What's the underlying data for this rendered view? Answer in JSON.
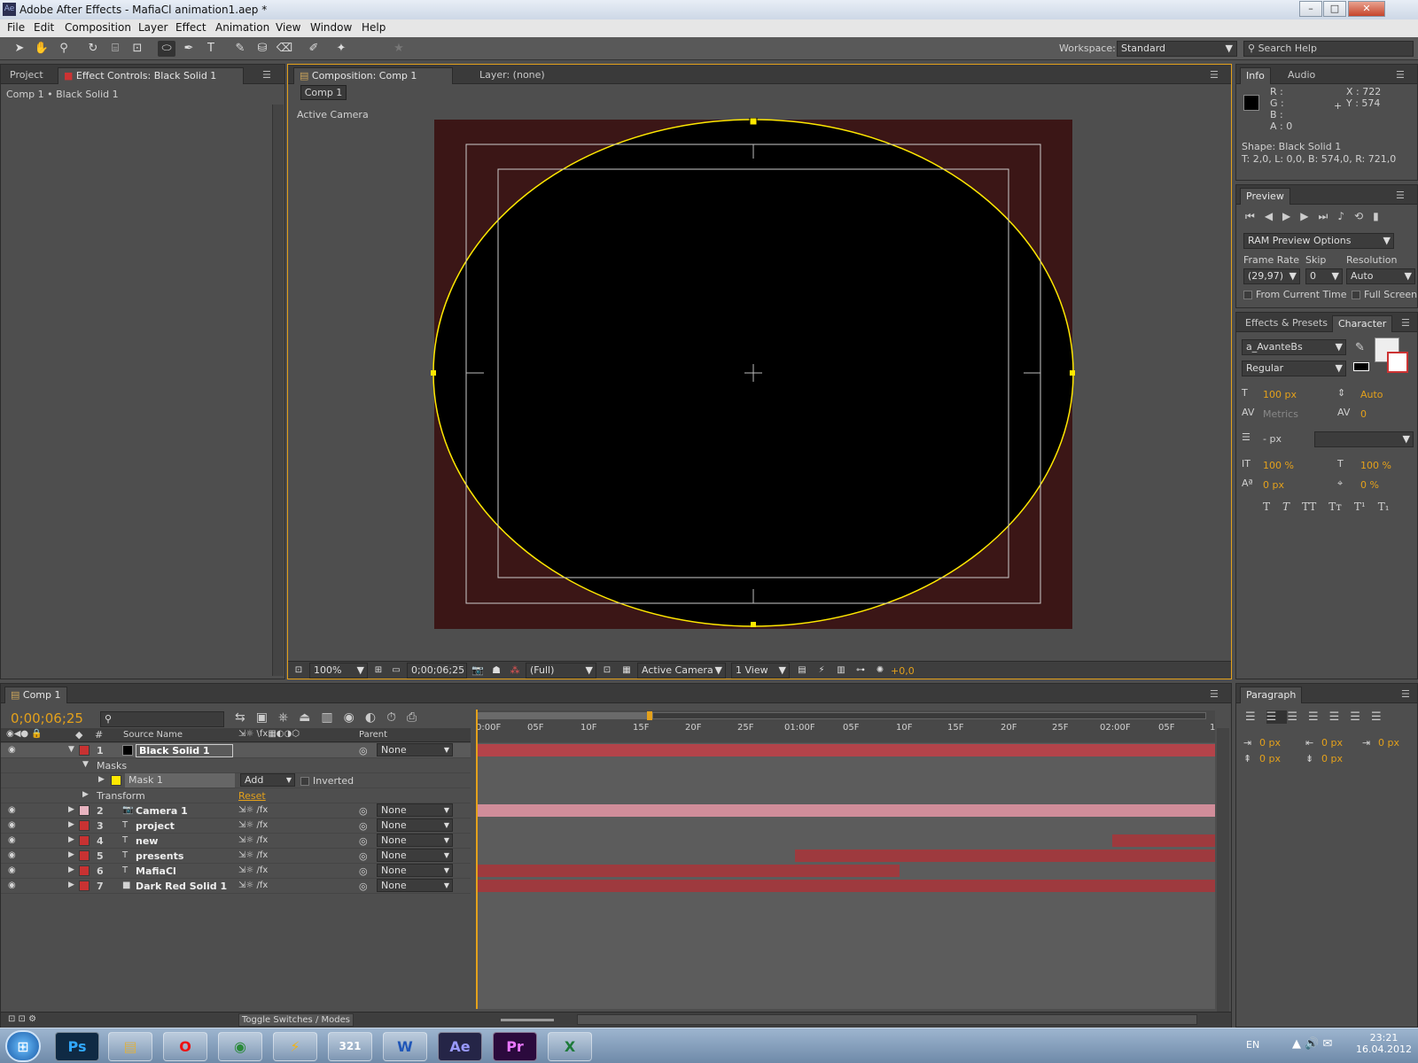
{
  "window": {
    "title": "Adobe After Effects - MafiaCl animation1.aep *",
    "app_badge": "Ae",
    "min": "–",
    "max": "□",
    "close": "✕"
  },
  "menu": [
    "File",
    "Edit",
    "Composition",
    "Layer",
    "Effect",
    "Animation",
    "View",
    "Window",
    "Help"
  ],
  "toolbar": {
    "workspace_label": "Workspace:",
    "workspace_value": "Standard",
    "search_placeholder": "Search Help"
  },
  "left_panel": {
    "tab_project": "Project",
    "tab_effect_controls": "Effect Controls: Black Solid 1",
    "breadcrumb": "Comp 1 • Black Solid 1"
  },
  "comp_panel": {
    "tab_comp": "Composition: Comp 1",
    "tab_layer": "Layer: (none)",
    "comp_button": "Comp 1",
    "camera_label": "Active Camera",
    "zoom": "100%",
    "timecode": "0;00;06;25",
    "resolution": "(Full)",
    "view_camera": "Active Camera",
    "view_count": "1 View",
    "exposure": "+0,0"
  },
  "info_panel": {
    "tab_info": "Info",
    "tab_audio": "Audio",
    "r": "R :",
    "g": "G :",
    "b": "B :",
    "a": "A : 0",
    "x": "X : 722",
    "y": "Y : 574",
    "shape": "Shape: Black Solid 1",
    "bounds": "T: 2,0, L: 0,0, B: 574,0, R: 721,0"
  },
  "preview_panel": {
    "tab": "Preview",
    "ram_options": "RAM Preview Options",
    "frame_rate_label": "Frame Rate",
    "skip_label": "Skip",
    "resolution_label": "Resolution",
    "frame_rate": "(29,97)",
    "skip": "0",
    "resolution": "Auto",
    "from_current": "From Current Time",
    "full_screen": "Full Screen"
  },
  "character_panel": {
    "tab_effects": "Effects & Presets",
    "tab_character": "Character",
    "font": "a_AvanteBs",
    "style": "Regular",
    "size": "100 px",
    "leading": "Auto",
    "kerning": "Metrics",
    "tracking": "0",
    "stroke": "- px",
    "vscale": "100 %",
    "hscale": "100 %",
    "baseline": "0 px",
    "tsume": "0 %",
    "styles": [
      "T",
      "T",
      "TT",
      "Tт",
      "T¹",
      "T₁"
    ]
  },
  "paragraph_panel": {
    "tab": "Paragraph",
    "indent_left": "0 px",
    "indent_right": "0 px",
    "indent_first": "0 px",
    "space_before": "0 px",
    "space_after": "0 px"
  },
  "timeline": {
    "tab": "Comp 1",
    "timecode": "0;00;06;25",
    "col_num": "#",
    "col_source": "Source Name",
    "col_parent": "Parent",
    "ruler": [
      "0:00F",
      "05F",
      "10F",
      "15F",
      "20F",
      "25F",
      "01:00F",
      "05F",
      "10F",
      "15F",
      "20F",
      "25F",
      "02:00F",
      "05F",
      "1"
    ],
    "masks_label": "Masks",
    "mask_name": "Mask 1",
    "mask_mode": "Add",
    "inverted": "Inverted",
    "transform_label": "Transform",
    "reset": "Reset",
    "toggle_label": "Toggle Switches / Modes",
    "layers": [
      {
        "num": "1",
        "name": "Black Solid 1",
        "parent": "None",
        "color": "#c83232",
        "type": "solid"
      },
      {
        "num": "2",
        "name": "Camera 1",
        "parent": "None",
        "color": "#e8b4c0",
        "type": "camera"
      },
      {
        "num": "3",
        "name": "project",
        "parent": "None",
        "color": "#c83232",
        "type": "text"
      },
      {
        "num": "4",
        "name": "new",
        "parent": "None",
        "color": "#c83232",
        "type": "text"
      },
      {
        "num": "5",
        "name": "presents",
        "parent": "None",
        "color": "#c83232",
        "type": "text"
      },
      {
        "num": "6",
        "name": "MafiaCl",
        "parent": "None",
        "color": "#c83232",
        "type": "text"
      },
      {
        "num": "7",
        "name": "Dark Red Solid 1",
        "parent": "None",
        "color": "#c83232",
        "type": "solid"
      }
    ]
  },
  "taskbar": {
    "apps": [
      "Ps",
      "▤",
      "O",
      "◉",
      "⚡",
      "321",
      "W",
      "Ae",
      "Pr",
      "X"
    ],
    "lang": "EN",
    "time": "23:21",
    "date": "16.04.2012"
  }
}
